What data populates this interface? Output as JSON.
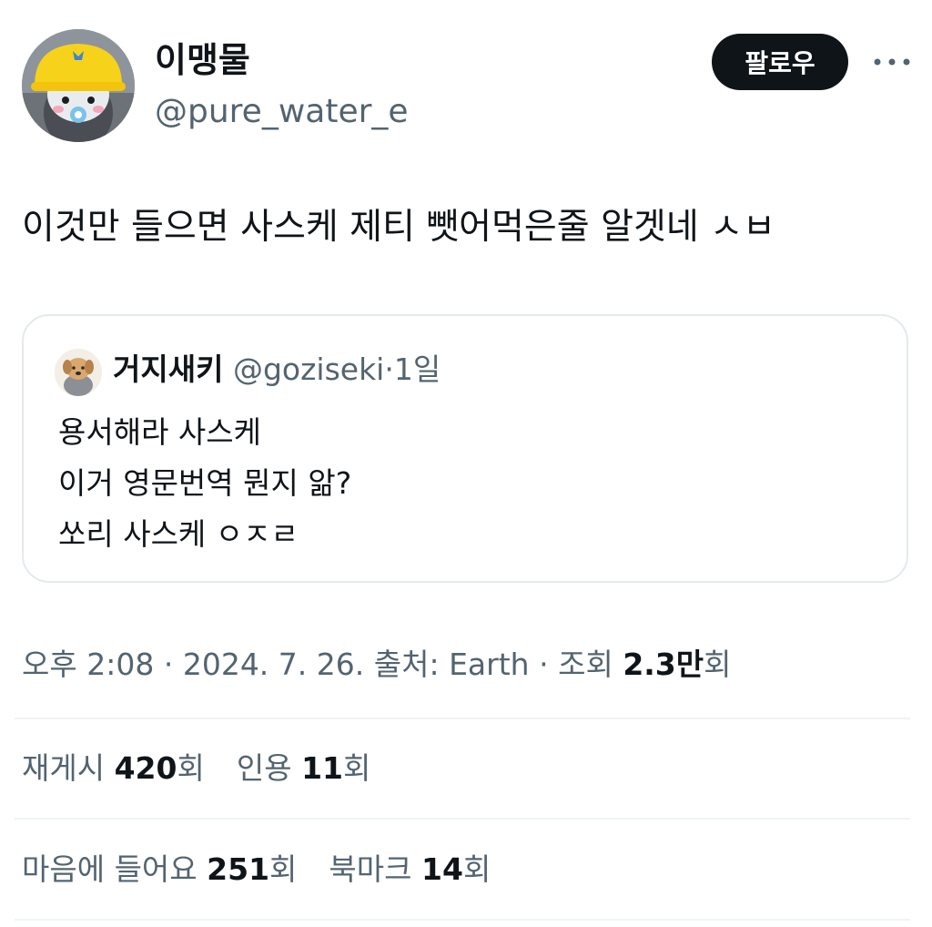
{
  "author": {
    "display_name": "이맹물",
    "handle": "@pure_water_e"
  },
  "follow_label": "팔로우",
  "more_label": "···",
  "tweet": {
    "text": "이것만 들으면 사스케 제티 뺏어먹은줄 알겟네 ㅅㅂ"
  },
  "quote": {
    "display_name": "거지새키",
    "handle": "@goziseki",
    "separator": "·",
    "time": "1일",
    "lines": [
      "용서해라 사스케",
      "이거 영문번역 뭔지 앎?",
      "쏘리 사스케 ㅇㅈㄹ"
    ]
  },
  "meta": {
    "time": "오후 2:08",
    "sep1": "·",
    "date": "2024. 7. 26.",
    "source": "출처: Earth",
    "sep2": "·",
    "views_label": "조회",
    "views_count": "2.3만",
    "views_suffix": "회"
  },
  "stats": {
    "retweets_label": "재게시",
    "retweets_count": "420",
    "retweets_suffix": "회",
    "quotes_label": "인용",
    "quotes_count": "11",
    "quotes_suffix": "회",
    "likes_label": "마음에 들어요",
    "likes_count": "251",
    "likes_suffix": "회",
    "bookmarks_label": "북마크",
    "bookmarks_count": "14",
    "bookmarks_suffix": "회"
  },
  "colors": {
    "text_primary": "#0f1419",
    "text_secondary": "#536471",
    "border": "#e4e9ec",
    "follow_bg": "#0f1419",
    "follow_text": "#ffffff",
    "helmet_yellow": "#f7d21a"
  },
  "icons": {
    "more": "more-dots-icon",
    "author_avatar": "penguin-hardhat-avatar",
    "quote_avatar": "dog-avatar"
  }
}
